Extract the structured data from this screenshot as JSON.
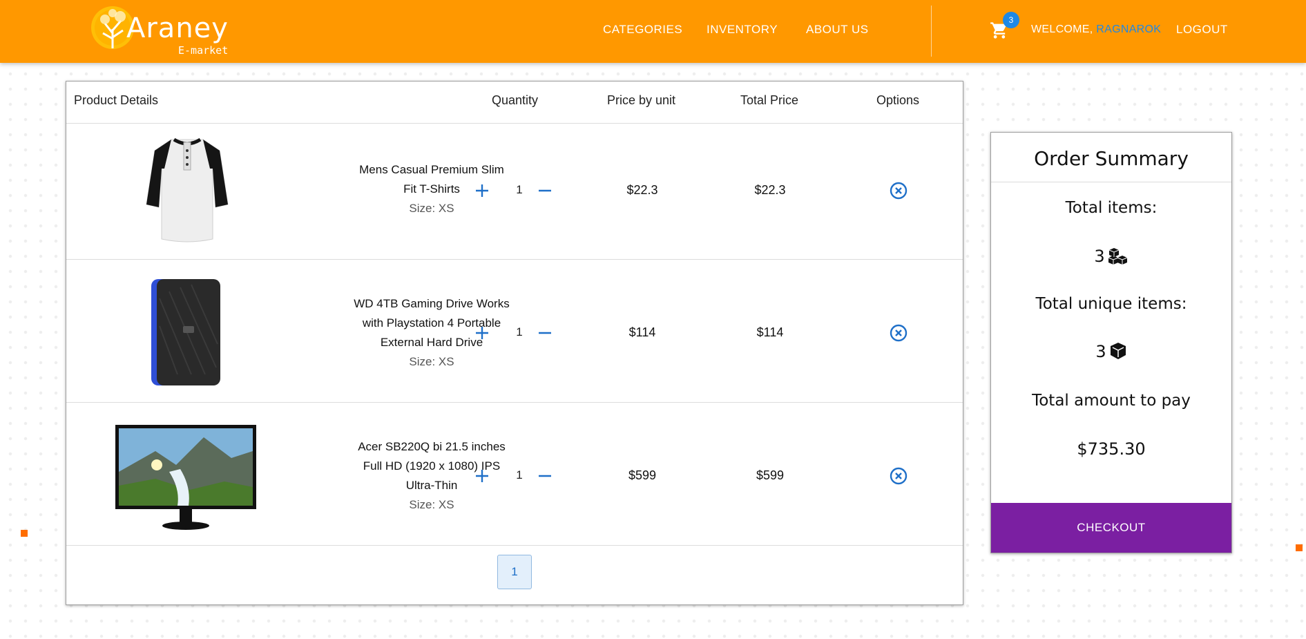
{
  "brand": {
    "name": "Araney",
    "subtitle": "E-market"
  },
  "nav": {
    "links": [
      "CATEGORIES",
      "INVENTORY",
      "ABOUT US"
    ],
    "cart_count": "3",
    "welcome_label": "WELCOME,",
    "username": "RAGNAROK",
    "logout": "LOGOUT"
  },
  "table": {
    "headers": {
      "product": "Product Details",
      "quantity": "Quantity",
      "unit_price": "Price by unit",
      "total": "Total Price",
      "options": "Options"
    },
    "rows": [
      {
        "image": "henley-shirt",
        "name": "Mens Casual Premium Slim Fit T-Shirts",
        "size": "Size: XS",
        "qty": "1",
        "unit_price": "$22.3",
        "total": "$22.3"
      },
      {
        "image": "external-hard-drive",
        "name": "WD 4TB Gaming Drive Works with Playstation 4 Portable External Hard Drive",
        "size": "Size: XS",
        "qty": "1",
        "unit_price": "$114",
        "total": "$114"
      },
      {
        "image": "monitor",
        "name": "Acer SB220Q bi 21.5 inches Full HD (1920 x 1080) IPS Ultra-Thin",
        "size": "Size: XS",
        "qty": "1",
        "unit_price": "$599",
        "total": "$599"
      }
    ],
    "current_page": "1"
  },
  "summary": {
    "title": "Order Summary",
    "total_items_label": "Total items:",
    "total_items": "3",
    "unique_items_label": "Total unique items:",
    "unique_items": "3",
    "amount_label": "Total amount to pay",
    "amount": "$735.30",
    "checkout": "CHECKOUT"
  },
  "colors": {
    "navbar": "#ff9800",
    "accent_blue": "#1e88e5",
    "checkout": "#7b1fa2"
  }
}
